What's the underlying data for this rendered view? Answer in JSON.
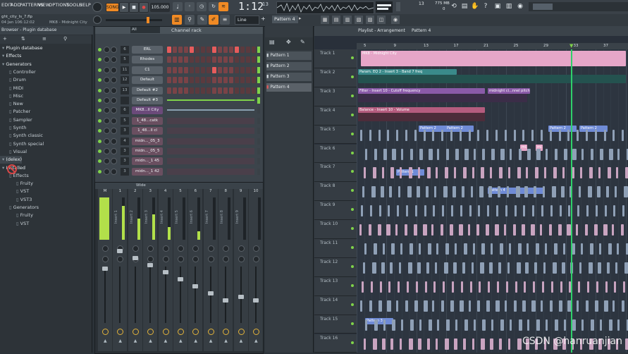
{
  "menu": [
    "EDIT",
    "ADD",
    "PATTERNS",
    "VIEW",
    "OPTIONS",
    "TOOLS",
    "HELP"
  ],
  "transport": {
    "mode": "SONG",
    "bpm": "105.000",
    "time": "1:12",
    "time_small": "13"
  },
  "project": {
    "file": "ght_city_Is_7.flp",
    "date": "04 Jan 106:12:02",
    "hint": "MK8 - Midnight City"
  },
  "stats": {
    "ram": "775 MB",
    "cpu": "13",
    "extra": "0"
  },
  "toolbar2": {
    "snap": "Line",
    "pattern": "Pattern 4",
    "channel_rack": "Channel rack",
    "filter_all": "All"
  },
  "browser": {
    "title": "Browser - Plugin database",
    "items": [
      {
        "label": "Plugin database",
        "level": 0,
        "head": true
      },
      {
        "label": "Effects",
        "level": 0,
        "head": true
      },
      {
        "label": "Generators",
        "level": 0,
        "head": true
      },
      {
        "label": "Controller",
        "level": 1
      },
      {
        "label": "Drum",
        "level": 1
      },
      {
        "label": "MIDI",
        "level": 1
      },
      {
        "label": "Misc",
        "level": 1
      },
      {
        "label": "New",
        "level": 1
      },
      {
        "label": "Patcher",
        "level": 1
      },
      {
        "label": "Sampler",
        "level": 1
      },
      {
        "label": "Synth",
        "level": 1
      },
      {
        "label": "Synth classic",
        "level": 1
      },
      {
        "label": "Synth special",
        "level": 1
      },
      {
        "label": "Visual",
        "level": 1
      },
      {
        "label": "(delex)",
        "level": 0,
        "head": true
      },
      {
        "label": "Installed",
        "level": 0,
        "head": true
      },
      {
        "label": "Effects",
        "level": 1
      },
      {
        "label": "Fruity",
        "level": 2
      },
      {
        "label": "VST",
        "level": 2
      },
      {
        "label": "VST3",
        "level": 2
      },
      {
        "label": "Generators",
        "level": 1
      },
      {
        "label": "Fruity",
        "level": 2
      },
      {
        "label": "VST",
        "level": 2
      }
    ]
  },
  "channels": [
    {
      "num": "6",
      "name": "ERL"
    },
    {
      "num": "5",
      "name": "Rhodes"
    },
    {
      "num": "11",
      "name": "C1"
    },
    {
      "num": "12",
      "name": "Default"
    },
    {
      "num": "13",
      "name": "Default #2"
    },
    {
      "num": "",
      "name": "Default #3"
    },
    {
      "num": "6",
      "name": "MK8...ll City"
    },
    {
      "num": "5",
      "name": "1_48...catk"
    },
    {
      "num": "3",
      "name": "1_48...ll cl"
    },
    {
      "num": "4",
      "name": "midn..._05_3"
    },
    {
      "num": "3",
      "name": "midn..._05_5"
    },
    {
      "num": "3",
      "name": "midn..._1 45"
    },
    {
      "num": "3",
      "name": "midn..._1 42"
    }
  ],
  "mixer": {
    "wide_label": "Wide",
    "strips": [
      "M",
      "1",
      "2",
      "3",
      "4",
      "5",
      "6",
      "7",
      "8",
      "9",
      "10"
    ],
    "insert_labels": [
      "Master",
      "Insert 1",
      "Insert 2",
      "Insert 3",
      "Insert 4",
      "Insert 5",
      "Insert 6",
      "Insert 7",
      "Insert 8",
      "Insert 9"
    ]
  },
  "patterns": [
    "Pattern 1",
    "Pattern 2",
    "Pattern 3",
    "Pattern 4"
  ],
  "playlist": {
    "title": "Playlist - Arrangement",
    "pattern": "Pattern 4",
    "bars": [
      "5",
      "9",
      "13",
      "17",
      "21",
      "25",
      "29",
      "33",
      "37"
    ],
    "tracks": [
      "Track 1",
      "Track 2",
      "Track 3",
      "Track 4",
      "Track 5",
      "Track 6",
      "Track 7",
      "Track 8",
      "Track 9",
      "Track 10",
      "Track 11",
      "Track 12",
      "Track 13",
      "Track 14",
      "Track 15",
      "Track 16"
    ],
    "automation": [
      "MK8 - Midnight City",
      "Param. EQ 2 - Insert 3 - Band 7 freq",
      "Filter - Insert 10 - Cutoff frequency",
      "midnight ci...nnel pitch",
      "Balance - Insert 10 - Volume"
    ],
    "clip_patterns": [
      "Pattern 2",
      "Pattern 2",
      "Pattern 2",
      "Pattern 2",
      "Pattern 1",
      "Pattern 4",
      "Pattern 3",
      "mi...2",
      "mi...2"
    ]
  },
  "watermark": "CSDN @hanruanjian",
  "colors": {
    "accent": "#f08a24",
    "led": "#7fd34a",
    "audio_pink": "#e6a6c8",
    "pattern_blue": "#6f8bd6",
    "auto_purple": "#8a5aa8",
    "teal": "#3a8a8a",
    "playhead": "#2fd06a"
  }
}
